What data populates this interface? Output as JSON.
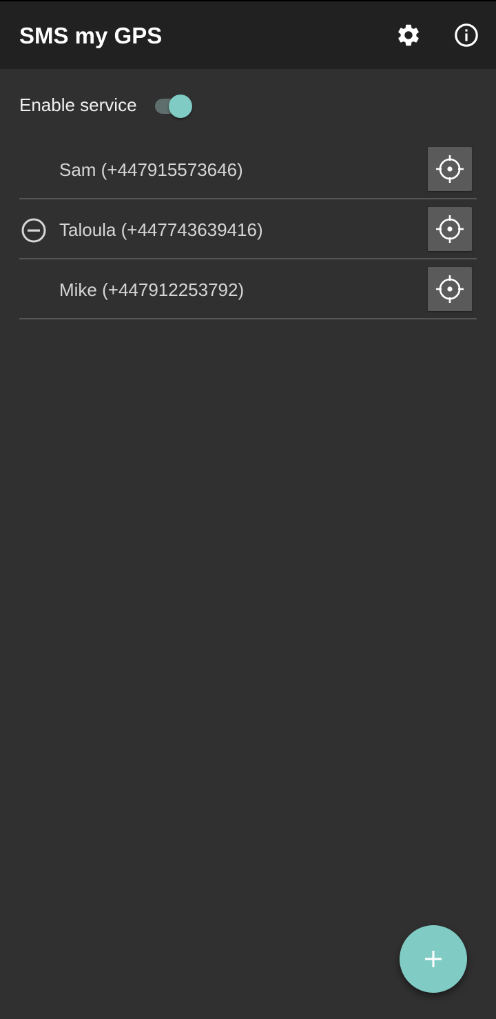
{
  "app_bar": {
    "title": "SMS my GPS",
    "actions": [
      {
        "icon": "gear-icon"
      },
      {
        "icon": "info-icon"
      }
    ]
  },
  "service": {
    "label": "Enable service",
    "enabled": true
  },
  "contacts": [
    {
      "label": "Sam (+447915573646)",
      "removable": false
    },
    {
      "label": "Taloula (+447743639416)",
      "removable": true
    },
    {
      "label": "Mike (+447912253792)",
      "removable": false
    }
  ],
  "fab": {
    "icon": "plus-icon"
  },
  "colors": {
    "background": "#303030",
    "app_bar": "#212121",
    "accent": "#80cbc4",
    "button": "#5a5a5a",
    "divider": "#555555"
  }
}
